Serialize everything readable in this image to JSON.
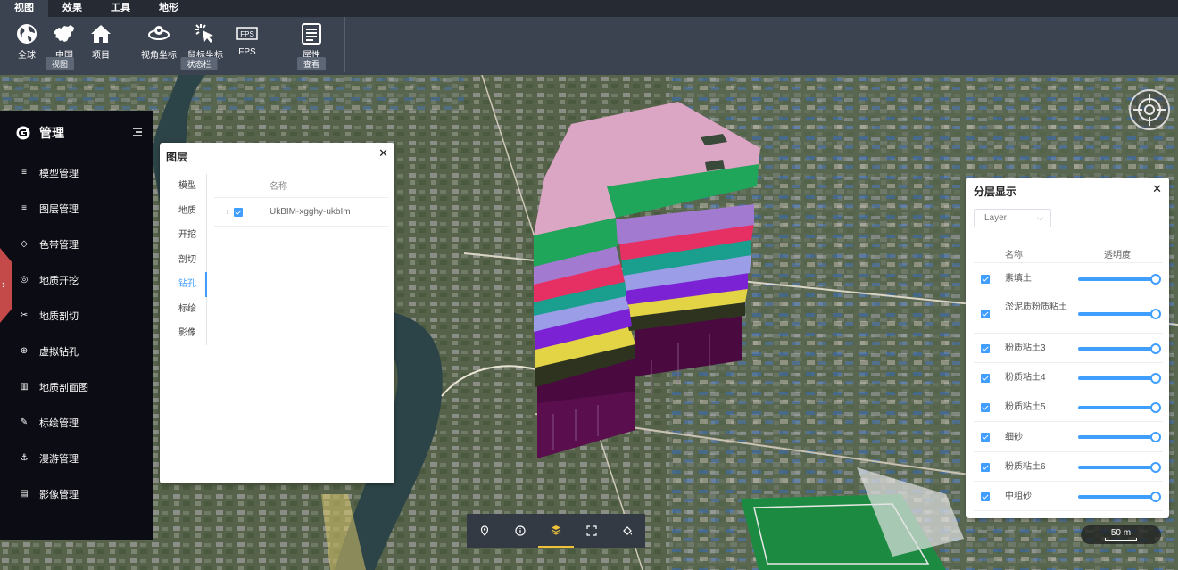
{
  "toolbar": {
    "tabs": [
      "视图",
      "效果",
      "工具",
      "地形"
    ],
    "groups": [
      {
        "label": "视图",
        "tools": [
          {
            "label": "全球",
            "icon": "globe-icon"
          },
          {
            "label": "中国",
            "icon": "china-map-icon"
          },
          {
            "label": "项目",
            "icon": "home-icon"
          }
        ]
      },
      {
        "label": "状态栏",
        "tools": [
          {
            "label": "视角坐标",
            "icon": "view-coordinate-icon"
          },
          {
            "label": "鼠标坐标",
            "icon": "cursor-click-icon"
          },
          {
            "label": "FPS",
            "icon": "fps-icon"
          }
        ]
      },
      {
        "label": "查看",
        "tools": [
          {
            "label": "属性",
            "icon": "document-icon"
          }
        ]
      }
    ]
  },
  "sidebar": {
    "title": "管理",
    "items": [
      {
        "label": "模型管理",
        "icon": "database-icon"
      },
      {
        "label": "图层管理",
        "icon": "database-icon"
      },
      {
        "label": "色带管理",
        "icon": "paint-bucket-icon"
      },
      {
        "label": "地质开挖",
        "icon": "excavate-icon"
      },
      {
        "label": "地质剖切",
        "icon": "scissors-icon"
      },
      {
        "label": "虚拟钻孔",
        "icon": "drill-icon"
      },
      {
        "label": "地质剖面图",
        "icon": "bar-chart-icon"
      },
      {
        "label": "标绘管理",
        "icon": "plot-icon"
      },
      {
        "label": "漫游管理",
        "icon": "anchor-icon"
      },
      {
        "label": "影像管理",
        "icon": "book-icon"
      }
    ]
  },
  "layer_panel": {
    "title": "图层",
    "tabs": [
      "模型",
      "地质",
      "开挖",
      "剖切",
      "钻孔",
      "标绘",
      "影像"
    ],
    "active_tab": "钻孔",
    "column_name": "名称",
    "rows": [
      {
        "name": "UkBIM-xgghy-ukbIm",
        "checked": true
      }
    ]
  },
  "strata_panel": {
    "title": "分层显示",
    "select_value": "Layer",
    "column_name": "名称",
    "column_opacity": "透明度",
    "rows": [
      {
        "name": "素填土",
        "checked": true,
        "opacity": 1
      },
      {
        "name": "淤泥质粉质粘土",
        "checked": true,
        "opacity": 1
      },
      {
        "name": "粉质粘土3",
        "checked": true,
        "opacity": 1
      },
      {
        "name": "粉质粘土4",
        "checked": true,
        "opacity": 1
      },
      {
        "name": "粉质粘土5",
        "checked": true,
        "opacity": 1
      },
      {
        "name": "细砂",
        "checked": true,
        "opacity": 1
      },
      {
        "name": "粉质粘土6",
        "checked": true,
        "opacity": 1
      },
      {
        "name": "中粗砂",
        "checked": true,
        "opacity": 1
      }
    ]
  },
  "bottom_toolbar": [
    {
      "icon": "location-pin-icon",
      "active": false
    },
    {
      "icon": "info-icon",
      "active": false
    },
    {
      "icon": "layers-icon",
      "active": true
    },
    {
      "icon": "fullscreen-icon",
      "active": false
    },
    {
      "icon": "paint-bucket-icon",
      "active": false
    }
  ],
  "scale_bar": "50 m",
  "colors": {
    "accent": "#409eff",
    "sidebar_bg": "#0c0c14",
    "toolbar_bg": "#3b4250",
    "strata": [
      "#dba6c4",
      "#1fa65a",
      "#a27ad0",
      "#e63063",
      "#1a9e8e",
      "#9b9de6",
      "#7b22d4",
      "#e2d444",
      "#2e3320",
      "#5a0e4e"
    ]
  }
}
